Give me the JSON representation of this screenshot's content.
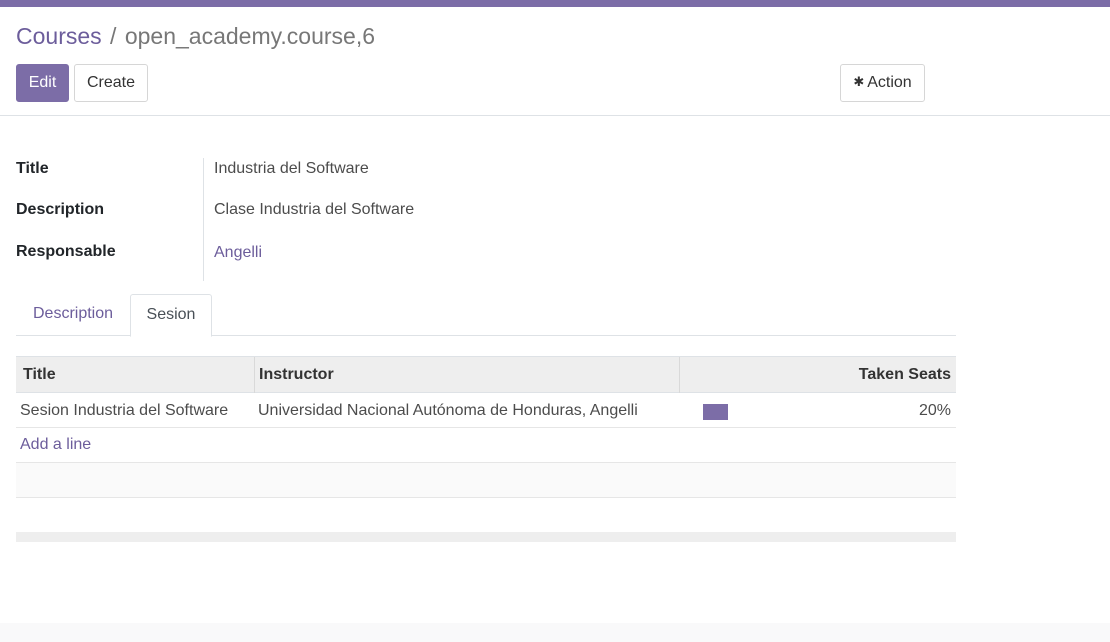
{
  "breadcrumb": {
    "parent": "Courses",
    "separator": "/",
    "current": "open_academy.course,6"
  },
  "buttons": {
    "edit": "Edit",
    "create": "Create",
    "action": "Action",
    "action_icon": "gear-icon"
  },
  "fields": [
    {
      "label": "Title",
      "value": "Industria del Software"
    },
    {
      "label": "Description",
      "value": "Clase Industria del Software"
    },
    {
      "label": "Responsable",
      "value": "Angelli"
    }
  ],
  "tabs": [
    {
      "label": "Description",
      "active": false
    },
    {
      "label": "Sesion",
      "active": true
    }
  ],
  "table": {
    "columns": [
      "Title",
      "Instructor",
      "Taken Seats"
    ],
    "rows": [
      {
        "title": "Sesion Industria del Software",
        "instructor": "Universidad Nacional Autónoma de Honduras, Angelli",
        "taken_seats_pct": 20,
        "taken_seats_label": "20%"
      }
    ],
    "add_line": "Add a line"
  },
  "colors": {
    "accent": "#7c6da7",
    "link": "#6c5d9b"
  }
}
